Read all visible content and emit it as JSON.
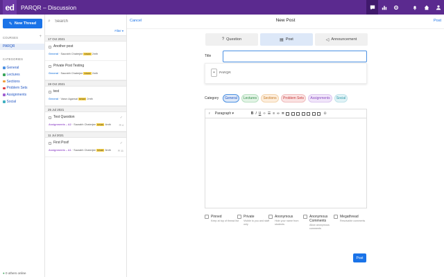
{
  "topbar": {
    "logo": "ed",
    "title": "PARQR – Discussion",
    "icons": [
      "chat-icon",
      "chart-icon",
      "gear-icon",
      "bell-icon",
      "home-icon",
      "user-icon"
    ]
  },
  "sidebar": {
    "new_thread": "New Thread",
    "courses_heading": "COURSES",
    "course": "PARQR",
    "categories_heading": "CATEGORIES",
    "categories": [
      {
        "label": "General",
        "color": "#4a90e2"
      },
      {
        "label": "Lectures",
        "color": "#3aa55a"
      },
      {
        "label": "Sections",
        "color": "#f0a040"
      },
      {
        "label": "Problem Sets",
        "color": "#e04040"
      },
      {
        "label": "Assignments",
        "color": "#a060d0"
      },
      {
        "label": "Social",
        "color": "#40b0c0"
      }
    ],
    "online": "0 others online"
  },
  "threadlist": {
    "search_placeholder": "Search",
    "filter": "Filter ▾",
    "groups": [
      {
        "date": "17 Oct 2021",
        "threads": [
          {
            "title": "Another post",
            "category": "General",
            "author": "Saurabh Chaterjee",
            "badge": "STAFF",
            "time": "2mth"
          },
          {
            "title": "Private Post Testing",
            "category": "General",
            "author": "Saurabh Chaterjee",
            "badge": "STAFF",
            "time": "2mth"
          }
        ]
      },
      {
        "date": "19 Oct 2021",
        "threads": [
          {
            "title": "test",
            "category": "General",
            "author": "Varun Agarwal",
            "badge": "STAFF",
            "time": "2mth"
          }
        ]
      },
      {
        "date": "25 Jul 2021",
        "threads": [
          {
            "title": "Test Question",
            "category": "Assignments – A2",
            "author": "Saurabh Chaterjee",
            "badge": "STAFF",
            "time": "4mth",
            "count": "4"
          }
        ]
      },
      {
        "date": "11 Jul 2021",
        "threads": [
          {
            "title": "First Post!",
            "category": "Assignments – A1",
            "author": "Saurabh Chaterjee",
            "badge": "STAFF",
            "time": "5mth",
            "count": "11"
          }
        ]
      }
    ]
  },
  "main": {
    "cancel": "Cancel",
    "title": "New Post",
    "post_link": "Post",
    "types": [
      {
        "label": "Question",
        "icon": "question-icon",
        "selected": false
      },
      {
        "label": "Post",
        "icon": "document-icon",
        "selected": true
      },
      {
        "label": "Announcement",
        "icon": "megaphone-icon",
        "selected": false
      }
    ],
    "title_label": "Title",
    "title_value": "",
    "suggestion": "PARQR",
    "category_label": "Category",
    "chips": [
      {
        "label": "General",
        "bg": "#dde8f8",
        "fg": "#2458c4",
        "border": "#4a90e2"
      },
      {
        "label": "Lectures",
        "bg": "#e3f4e6",
        "fg": "#2f8a45",
        "border": "#b7e0c0"
      },
      {
        "label": "Sections",
        "bg": "#fdeedd",
        "fg": "#c57720",
        "border": "#f3d3ab"
      },
      {
        "label": "Problem Sets",
        "bg": "#fbe3e3",
        "fg": "#c63a3a",
        "border": "#f0bcbc"
      },
      {
        "label": "Assignments",
        "bg": "#f1e6fa",
        "fg": "#8a4cc0",
        "border": "#dcc5ef"
      },
      {
        "label": "Social",
        "bg": "#e1f3f6",
        "fg": "#2d98a8",
        "border": "#bfe3ea"
      }
    ],
    "toolbar": {
      "paragraph": "Paragraph"
    },
    "options": [
      {
        "name": "Pinned",
        "desc": "Keep at top of thread list"
      },
      {
        "name": "Private",
        "desc": "Visible to you and staff only"
      },
      {
        "name": "Anonymous",
        "desc": "Hide your name from students"
      },
      {
        "name": "Anonymous Comments",
        "desc": "Allow anonymous comments"
      },
      {
        "name": "Megathread",
        "desc": "Resolvable comments"
      }
    ],
    "post_button": "Post"
  }
}
